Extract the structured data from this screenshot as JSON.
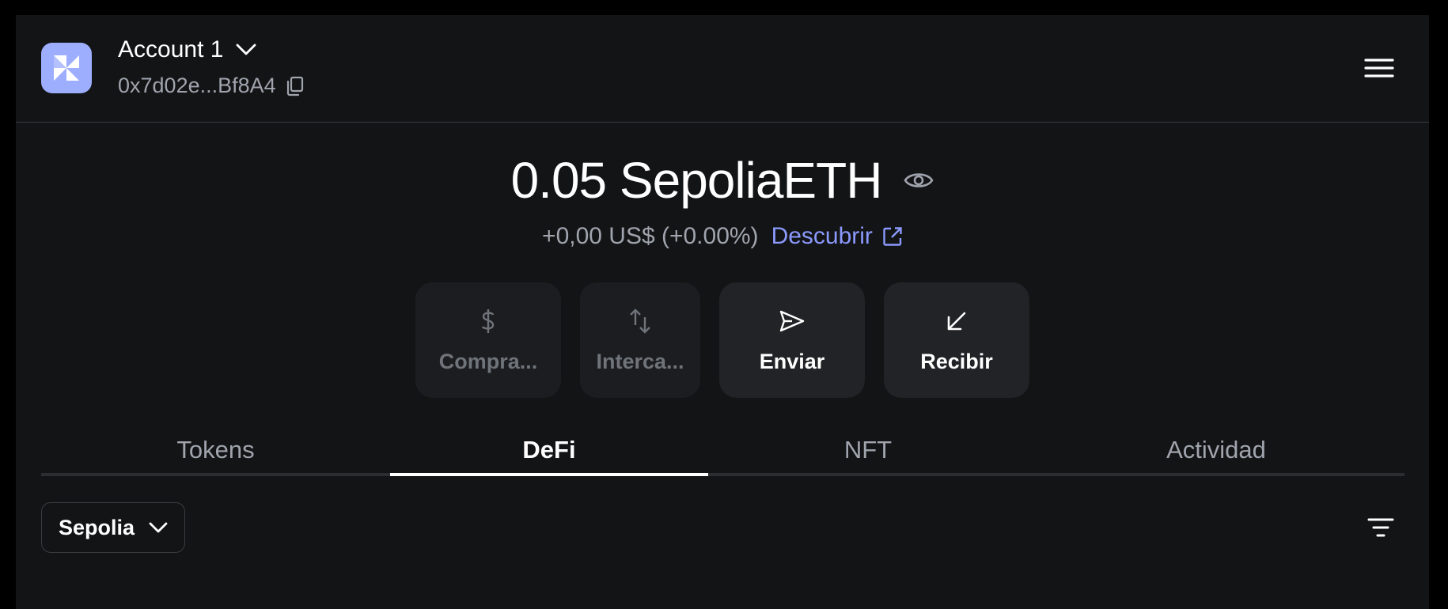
{
  "header": {
    "account_name": "Account 1",
    "account_address": "0x7d02e...Bf8A4"
  },
  "balance": {
    "amount": "0.05 SepoliaETH",
    "change": "+0,00 US$ (+0.00%)",
    "discover_label": "Descubrir"
  },
  "actions": [
    {
      "label": "Compra...",
      "icon": "dollar-icon",
      "enabled": false
    },
    {
      "label": "Interca...",
      "icon": "swap-arrows-icon",
      "enabled": false
    },
    {
      "label": "Enviar",
      "icon": "send-arrow-icon",
      "enabled": true
    },
    {
      "label": "Recibir",
      "icon": "receive-arrow-icon",
      "enabled": true
    }
  ],
  "tabs": [
    {
      "label": "Tokens",
      "active": false
    },
    {
      "label": "DeFi",
      "active": true
    },
    {
      "label": "NFT",
      "active": false
    },
    {
      "label": "Actividad",
      "active": false
    }
  ],
  "filters": {
    "network": "Sepolia"
  },
  "colors": {
    "background": "#131416",
    "accent": "#8b99fc",
    "avatar": "#9eaefe",
    "muted_text": "#9fa4ad",
    "button_bg": "#222326"
  }
}
